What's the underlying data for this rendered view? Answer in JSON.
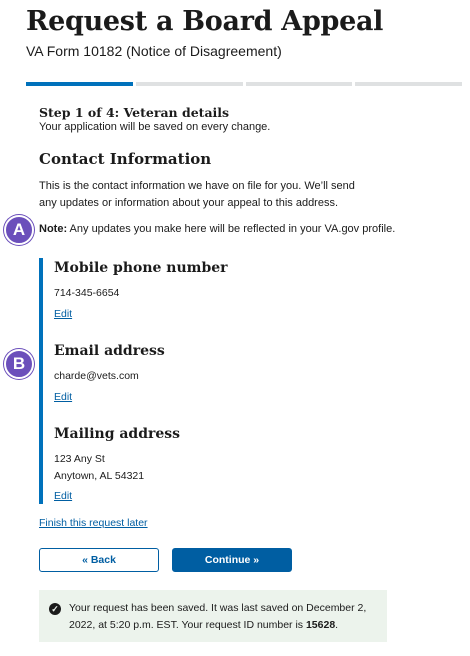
{
  "page": {
    "title": "Request a Board Appeal",
    "subtitle": "VA Form 10182 (Notice of Disagreement)"
  },
  "progress": {
    "total_steps": 4,
    "current_step": 1
  },
  "step": {
    "title": "Step 1 of 4: Veteran details",
    "subtitle": "Your application will be saved on every change."
  },
  "contact": {
    "heading": "Contact Information",
    "intro": "This is the contact information we have on file for you. We’ll send any updates or information about your appeal to this address.",
    "note_label": "Note:",
    "note_text": " Any updates you make here will be reflected in your VA.gov profile."
  },
  "markers": {
    "a": "A",
    "b": "B"
  },
  "mobile": {
    "title": "Mobile phone number",
    "value": "714-345-6654",
    "edit": "Edit"
  },
  "email": {
    "title": "Email address",
    "value": "charde@vets.com",
    "edit": "Edit"
  },
  "mailing": {
    "title": "Mailing address",
    "line1": "123 Any St",
    "line2": "Anytown, AL 54321",
    "edit": "Edit"
  },
  "finish_link": "Finish this request later",
  "buttons": {
    "back": "« Back",
    "continue": "Continue »"
  },
  "alert": {
    "icon": "check-circle-icon",
    "text_before": "Your request has been saved. It was last saved on December 2, 2022, at 5:20 p.m. EST. Your request ID number is ",
    "request_id": "15628",
    "text_after": "."
  },
  "colors": {
    "primary": "#005ea2",
    "progress_active": "#0071bb",
    "progress_inactive": "#dfe1e2",
    "marker": "#6b4fbb",
    "alert_bg": "#ecf3ec"
  }
}
